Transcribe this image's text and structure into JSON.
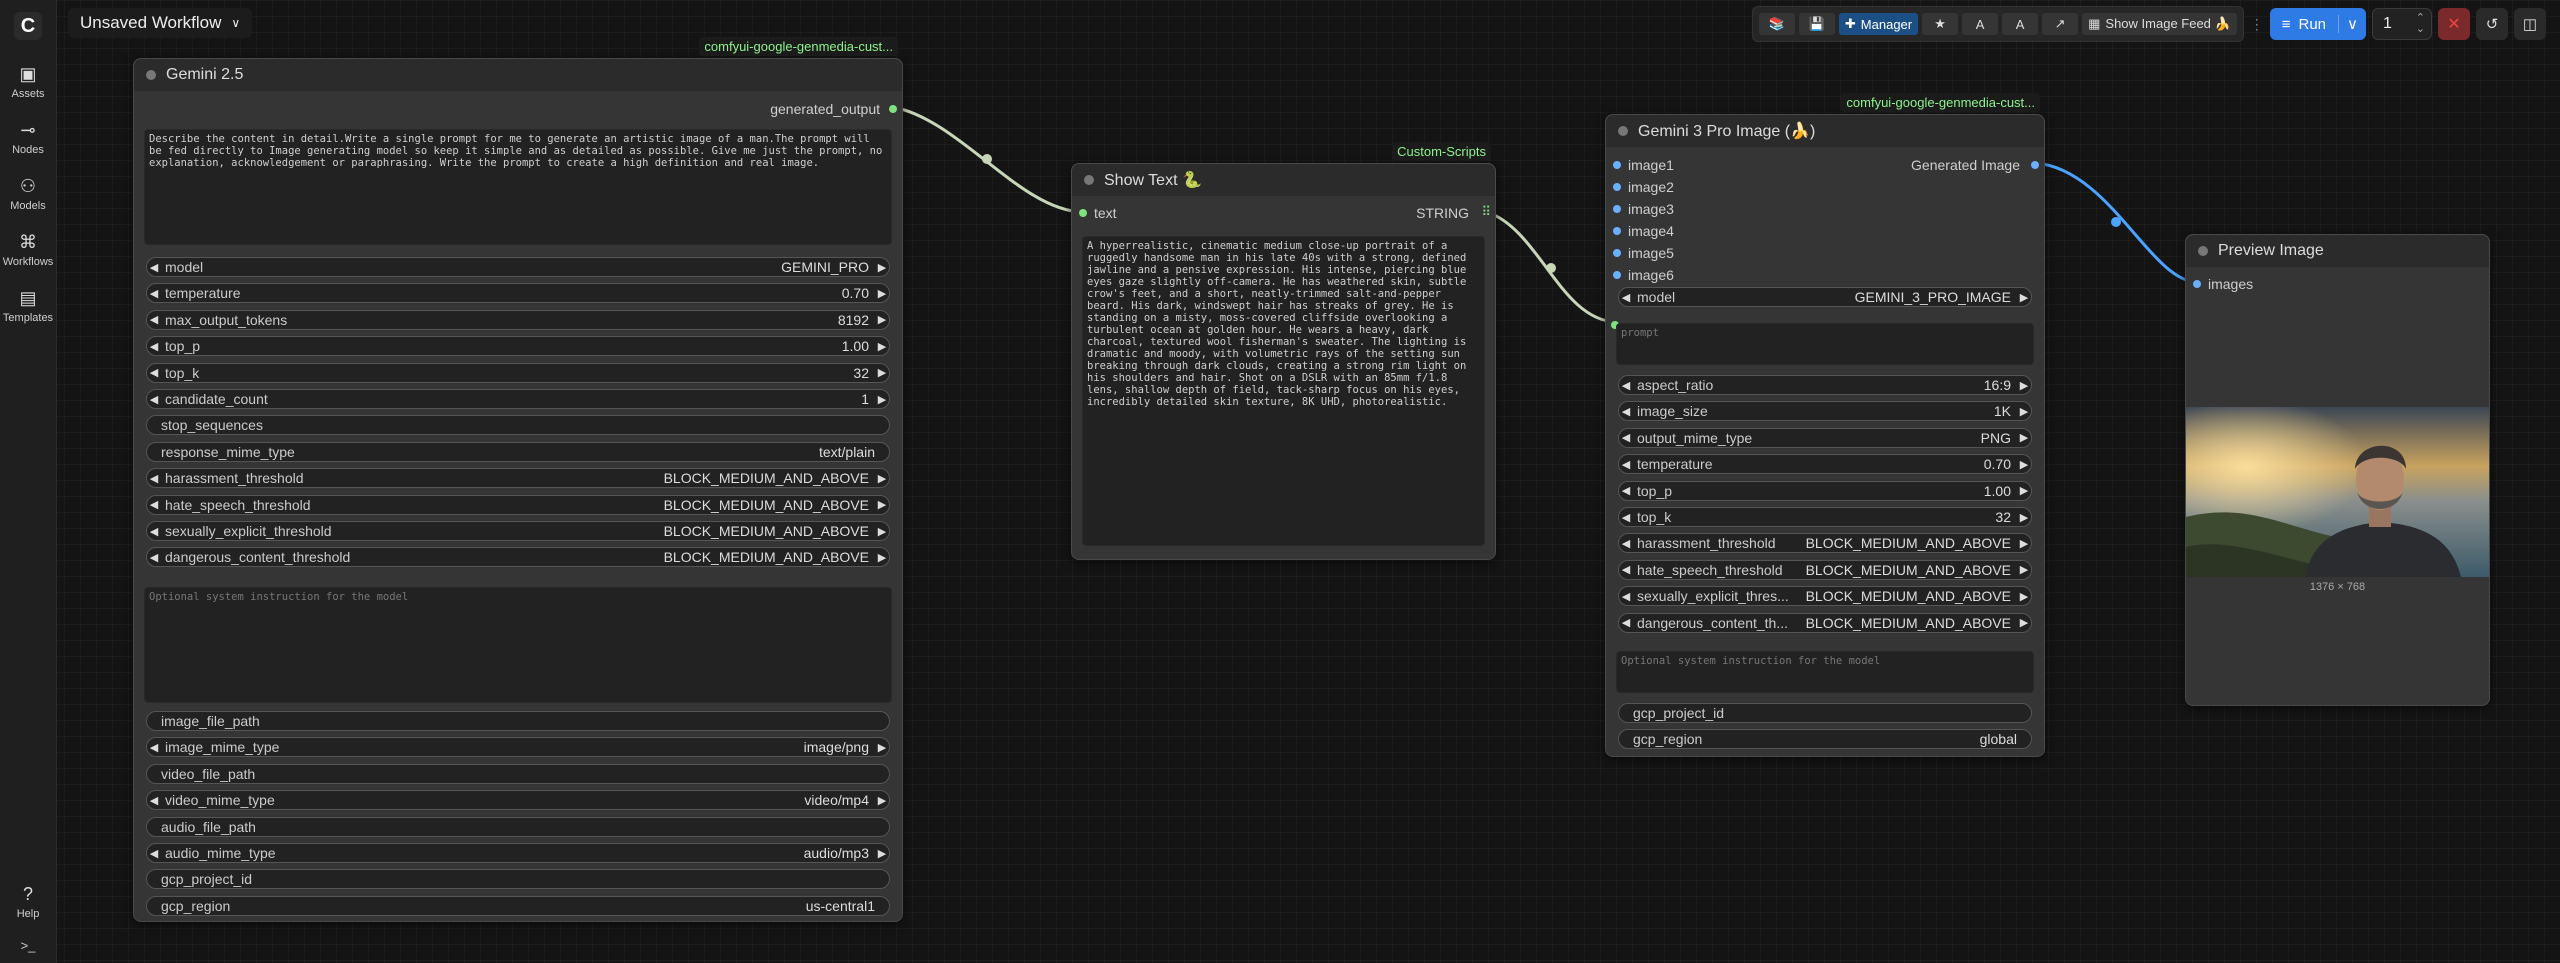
{
  "app": {
    "workflow_title": "Unsaved Workflow",
    "sidebar": [
      {
        "label": "Assets",
        "icon": "assets-icon",
        "glyph": "▣"
      },
      {
        "label": "Nodes",
        "icon": "nodes-icon",
        "glyph": "⊸"
      },
      {
        "label": "Models",
        "icon": "models-icon",
        "glyph": "⚇"
      },
      {
        "label": "Workflows",
        "icon": "workflows-icon",
        "glyph": "⌘"
      },
      {
        "label": "Templates",
        "icon": "templates-icon",
        "glyph": "▤"
      }
    ],
    "help_label": "Help",
    "help_glyph": "?",
    "terminal_glyph": ">_",
    "logo_glyph": "C"
  },
  "topbar": {
    "manager_label": "Manager",
    "image_feed_label": "Show Image Feed 🍌",
    "run_label": "Run",
    "queue_count": "1",
    "glyphs": {
      "books": "📚",
      "save": "💾",
      "puzzle": "✚",
      "star": "★",
      "a1": "A",
      "a2": "A",
      "share": "↗",
      "feed": "▦",
      "run": "≡",
      "chev": "∨",
      "up": "⌃",
      "down": "⌄",
      "stop": "✕",
      "history": "↺",
      "panel": "◫",
      "drag": "⋮"
    }
  },
  "glyphs": {
    "left": "◀",
    "right": "▶",
    "grid": "⠿"
  },
  "node_gemini": {
    "title": "Gemini 2.5",
    "badge": "comfyui-google-genmedia-cust...",
    "output": "generated_output",
    "prompt": "Describe the content in detail.Write a single prompt for me to generate an artistic image of a man.The prompt will be fed directly to Image generating model so keep it simple and as detailed as possible. Give me just the prompt, no explanation, acknowledgement or paraphrasing. Write the prompt to create a high definition and real image.",
    "widgets1": [
      {
        "label": "model",
        "value": "GEMINI_PRO",
        "arrows": true
      },
      {
        "label": "temperature",
        "value": "0.70",
        "arrows": true
      },
      {
        "label": "max_output_tokens",
        "value": "8192",
        "arrows": true
      },
      {
        "label": "top_p",
        "value": "1.00",
        "arrows": true
      },
      {
        "label": "top_k",
        "value": "32",
        "arrows": true
      },
      {
        "label": "candidate_count",
        "value": "1",
        "arrows": true
      },
      {
        "label": "stop_sequences",
        "value": "",
        "arrows": false
      },
      {
        "label": "response_mime_type",
        "value": "text/plain",
        "arrows": false
      },
      {
        "label": "harassment_threshold",
        "value": "BLOCK_MEDIUM_AND_ABOVE",
        "arrows": true
      },
      {
        "label": "hate_speech_threshold",
        "value": "BLOCK_MEDIUM_AND_ABOVE",
        "arrows": true
      },
      {
        "label": "sexually_explicit_threshold",
        "value": "BLOCK_MEDIUM_AND_ABOVE",
        "arrows": true
      },
      {
        "label": "dangerous_content_threshold",
        "value": "BLOCK_MEDIUM_AND_ABOVE",
        "arrows": true
      }
    ],
    "system_placeholder": "Optional system instruction for the model",
    "widgets2": [
      {
        "label": "image_file_path",
        "value": "",
        "arrows": false
      },
      {
        "label": "image_mime_type",
        "value": "image/png",
        "arrows": true
      },
      {
        "label": "video_file_path",
        "value": "",
        "arrows": false
      },
      {
        "label": "video_mime_type",
        "value": "video/mp4",
        "arrows": true
      },
      {
        "label": "audio_file_path",
        "value": "",
        "arrows": false
      },
      {
        "label": "audio_mime_type",
        "value": "audio/mp3",
        "arrows": true
      },
      {
        "label": "gcp_project_id",
        "value": "",
        "arrows": false
      },
      {
        "label": "gcp_region",
        "value": "us-central1",
        "arrows": false
      }
    ]
  },
  "node_show_text": {
    "title": "Show Text 🐍",
    "badge": "Custom-Scripts",
    "input": "text",
    "output": "STRING",
    "text": "A hyperrealistic, cinematic medium close-up portrait of a ruggedly handsome man in his late 40s with a strong, defined jawline and a pensive expression. His intense, piercing blue eyes gaze slightly off-camera. He has weathered skin, subtle crow's feet, and a short, neatly-trimmed salt-and-pepper beard. His dark, windswept hair has streaks of grey. He is standing on a misty, moss-covered cliffside overlooking a turbulent ocean at golden hour. He wears a heavy, dark charcoal, textured wool fisherman's sweater. The lighting is dramatic and moody, with volumetric rays of the setting sun breaking through dark clouds, creating a strong rim light on his shoulders and hair. Shot on a DSLR with an 85mm f/1.8 lens, shallow depth of field, tack-sharp focus on his eyes, incredibly detailed skin texture, 8K UHD, photorealistic."
  },
  "node_gemini3": {
    "title": "Gemini 3 Pro Image (🍌)",
    "badge": "comfyui-google-genmedia-cust...",
    "inputs": [
      "image1",
      "image2",
      "image3",
      "image4",
      "image5",
      "image6"
    ],
    "output": "Generated Image",
    "model": {
      "label": "model",
      "value": "GEMINI_3_PRO_IMAGE"
    },
    "prompt_placeholder": "prompt",
    "widgets": [
      {
        "label": "aspect_ratio",
        "value": "16:9",
        "arrows": true
      },
      {
        "label": "image_size",
        "value": "1K",
        "arrows": true
      },
      {
        "label": "output_mime_type",
        "value": "PNG",
        "arrows": true
      },
      {
        "label": "temperature",
        "value": "0.70",
        "arrows": true
      },
      {
        "label": "top_p",
        "value": "1.00",
        "arrows": true
      },
      {
        "label": "top_k",
        "value": "32",
        "arrows": true
      },
      {
        "label": "harassment_threshold",
        "value": "BLOCK_MEDIUM_AND_ABOVE",
        "arrows": true
      },
      {
        "label": "hate_speech_threshold",
        "value": "BLOCK_MEDIUM_AND_ABOVE",
        "arrows": true
      },
      {
        "label": "sexually_explicit_thres...",
        "value": "BLOCK_MEDIUM_AND_ABOVE",
        "arrows": true
      },
      {
        "label": "dangerous_content_th...",
        "value": "BLOCK_MEDIUM_AND_ABOVE",
        "arrows": true
      }
    ],
    "system_placeholder": "Optional system instruction for the model",
    "widgets2": [
      {
        "label": "gcp_project_id",
        "value": "",
        "arrows": false
      },
      {
        "label": "gcp_region",
        "value": "global",
        "arrows": false
      }
    ]
  },
  "node_preview": {
    "title": "Preview Image",
    "input": "images",
    "dimensions": "1376 × 768"
  },
  "colors": {
    "link_green": "#c8d6b8",
    "link_blue": "#4aa3ff",
    "slot_green": "#7ee37e",
    "slot_blue": "#6ab0ff",
    "run_blue": "#2f7be5"
  }
}
